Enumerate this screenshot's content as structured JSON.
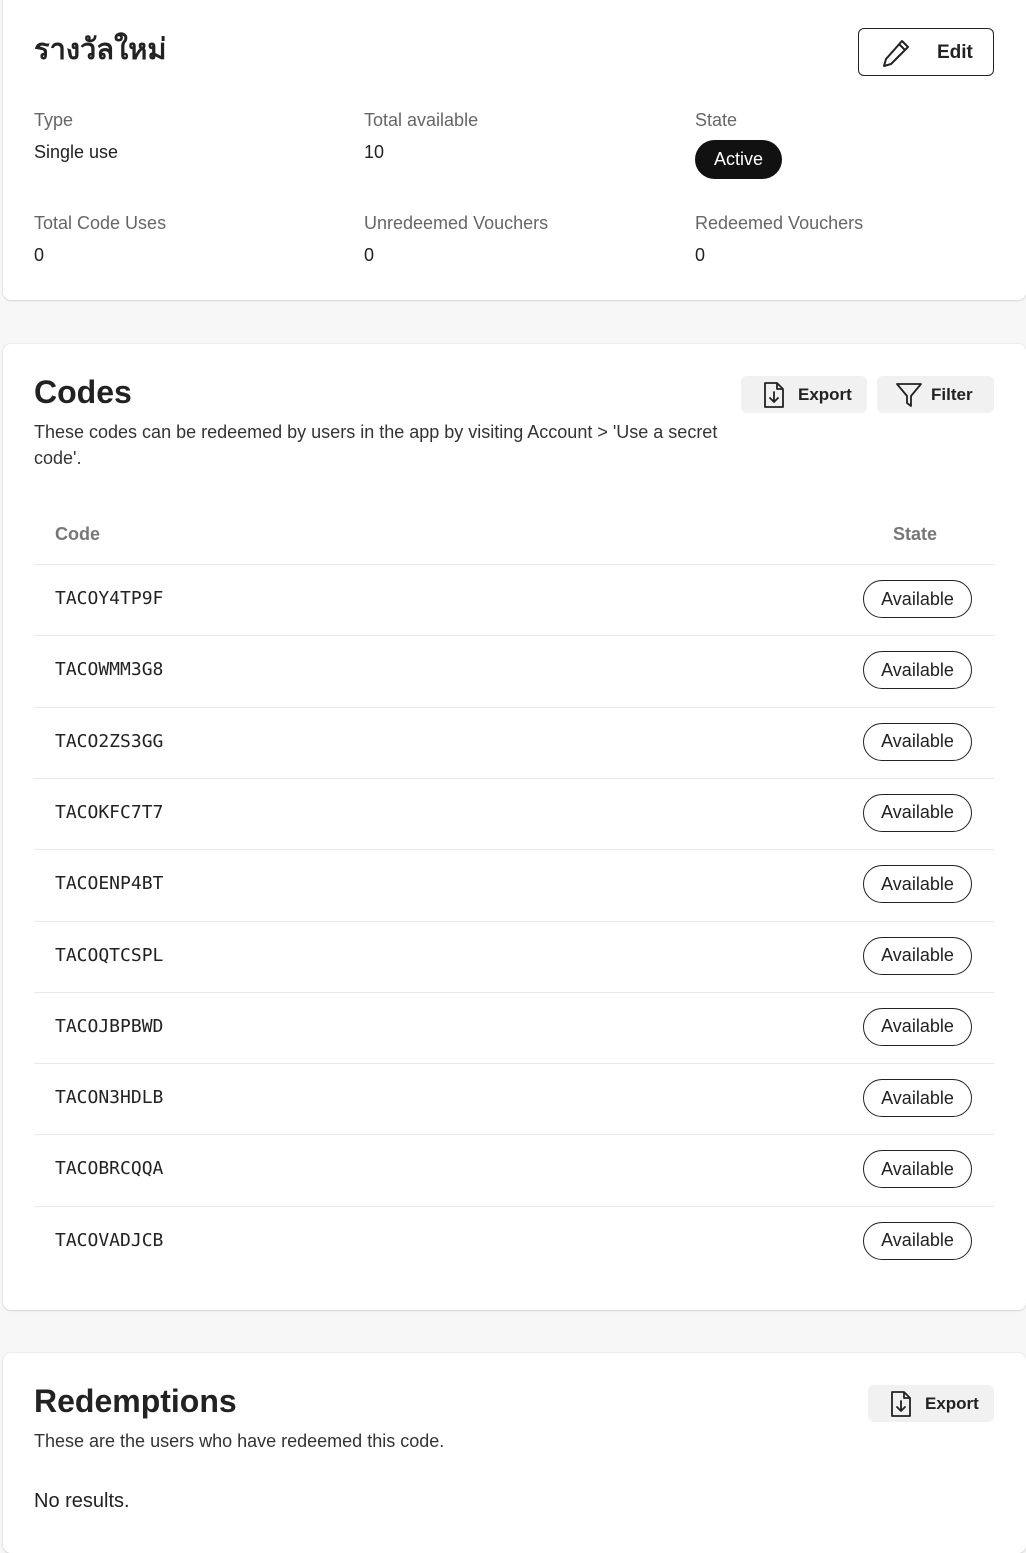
{
  "reward": {
    "title": "รางวัลใหม่",
    "edit_label": "Edit",
    "type_label": "Type",
    "type_value": "Single use",
    "total_available_label": "Total available",
    "total_available_value": "10",
    "state_label": "State",
    "state_value": "Active",
    "total_code_uses_label": "Total Code Uses",
    "total_code_uses_value": "0",
    "unredeemed_label": "Unredeemed Vouchers",
    "unredeemed_value": "0",
    "redeemed_label": "Redeemed Vouchers",
    "redeemed_value": "0"
  },
  "codes": {
    "title": "Codes",
    "description": "These codes can be redeemed by users in the app by visiting Account > 'Use a secret code'.",
    "export_label": "Export",
    "filter_label": "Filter",
    "columns": {
      "code": "Code",
      "state": "State"
    },
    "rows": [
      {
        "code": "TACOY4TP9F",
        "state": "Available"
      },
      {
        "code": "TACOWMM3G8",
        "state": "Available"
      },
      {
        "code": "TACO2ZS3GG",
        "state": "Available"
      },
      {
        "code": "TACOKFC7T7",
        "state": "Available"
      },
      {
        "code": "TACOENP4BT",
        "state": "Available"
      },
      {
        "code": "TACOQTCSPL",
        "state": "Available"
      },
      {
        "code": "TACOJBPBWD",
        "state": "Available"
      },
      {
        "code": "TACON3HDLB",
        "state": "Available"
      },
      {
        "code": "TACOBRCQQA",
        "state": "Available"
      },
      {
        "code": "TACOVADJCB",
        "state": "Available"
      }
    ]
  },
  "redemptions": {
    "title": "Redemptions",
    "description": "These are the users who have redeemed this code.",
    "export_label": "Export",
    "empty_text": "No results."
  },
  "icons": {
    "edit": "pencil-icon",
    "export": "file-download-icon",
    "filter": "funnel-icon"
  }
}
